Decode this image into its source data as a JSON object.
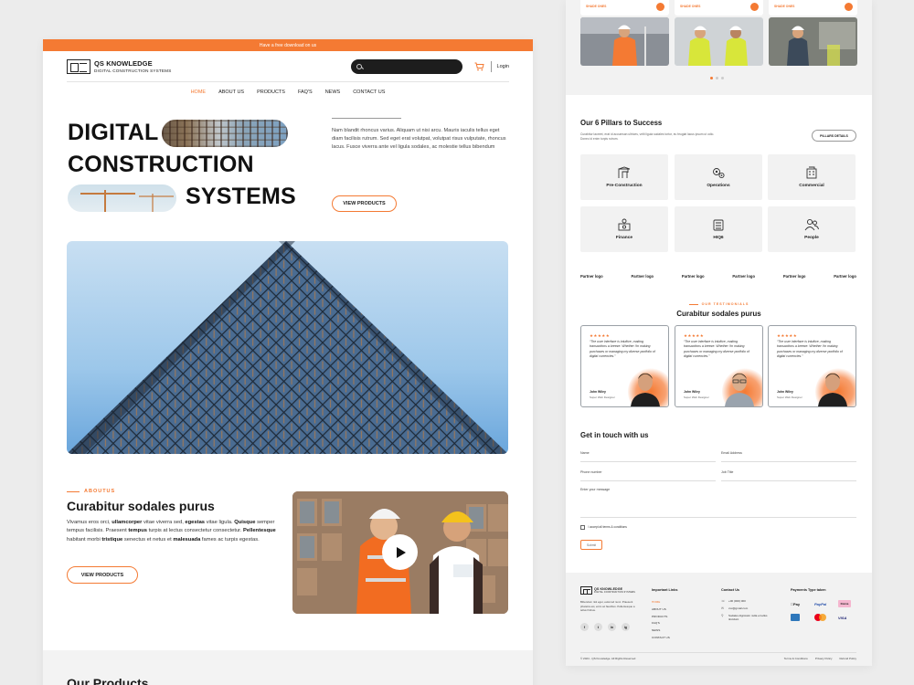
{
  "topbar": {
    "text": "Have a free download on us"
  },
  "brand": {
    "name": "QS KNOWLEDGE",
    "tagline": "DIGITAL CONSTRUCTION SYSTEMS"
  },
  "header": {
    "login": "Login",
    "search_placeholder": ""
  },
  "nav": [
    {
      "label": "HOME",
      "active": true
    },
    {
      "label": "ABOUT US"
    },
    {
      "label": "PRODUCTS"
    },
    {
      "label": "FAQ'S"
    },
    {
      "label": "NEWS"
    },
    {
      "label": "CONTACT US"
    }
  ],
  "hero": {
    "line1": "DIGITAL",
    "line2": "CONSTRUCTION",
    "line3": "SYSTEMS",
    "description": "Nam blandit rhoncus varius. Aliquam ut nisi arcu. Mauris iaculis tellus eget diam facilisis rutrum. Sed eget erat volutpat, volutpat risus vulputate, rhoncus lacus. Fusce viverra ante vel ligula sodales, ac molestie tellus bibendum",
    "cta": "VIEW PRODUCTS"
  },
  "about": {
    "tag": "ABOUTUS",
    "title": "Curabitur sodales purus",
    "text_html": "Vivamus eros orci, <b>ullamcorper</b> vitae viverra sed, <b>egestas</b> vitae ligula. <b>Quisque</b> semper tempus facilisis. Praesent <b>tempus</b> turpis at lectus consectetur consectetur. <b>Pellentesque</b> habitant morbi <b>tristique</b> senectus et netus et <b>malesuada</b> fames ac turpis egestas.",
    "cta": "VIEW PRODUCTS"
  },
  "products": {
    "title": "Our Products"
  },
  "top_cards": [
    {
      "label": "SHADE ONES"
    },
    {
      "label": "SHADE ONES"
    },
    {
      "label": "SHADE ONES"
    }
  ],
  "pillars": {
    "title": "Our 6 Pillars to Success",
    "description": "Curabitur laoreet, erat id accumsan ultrices, velit ligula sodales tortor, eu feugiat lacus ipsum ut odio. Donec id enim turpis rutrum.",
    "button": "PILLARS DETAILS",
    "items": [
      {
        "label": "Pre-Construction",
        "icon": "crane-icon"
      },
      {
        "label": "Operations",
        "icon": "gears-icon"
      },
      {
        "label": "Commercial",
        "icon": "building-icon"
      },
      {
        "label": "Finance",
        "icon": "money-icon"
      },
      {
        "label": "HIQ6",
        "icon": "office-icon"
      },
      {
        "label": "People",
        "icon": "people-icon"
      }
    ]
  },
  "partners": [
    "Partner logo",
    "Partner logo",
    "Partner logo",
    "Partner logo",
    "Partner logo",
    "Partner logo"
  ],
  "testimonials": {
    "tag": "OUR TESTIMONIALS",
    "title": "Curabitur sodales purus",
    "items": [
      {
        "stars": "★★★★★",
        "quote": "“The user interface is intuitive, making transactions a breeze. Whether I'm making purchases or managing my diverse portfolio of digital currencies.”",
        "name": "John Wiley",
        "role": "Super Web Designer"
      },
      {
        "stars": "★★★★★",
        "quote": "“The user interface is intuitive, making transactions a breeze. Whether I'm making purchases or managing my diverse portfolio of digital currencies.”",
        "name": "John Wiley",
        "role": "Super Web Designer"
      },
      {
        "stars": "★★★★★",
        "quote": "“The user interface is intuitive, making transactions a breeze. Whether I'm making purchases or managing my diverse portfolio of digital currencies.”",
        "name": "John Wiley",
        "role": "Super Web Designer"
      }
    ]
  },
  "contact": {
    "title": "Get in touch with us",
    "fields": {
      "name": "Name",
      "email": "Email Address",
      "phone": "Phone number",
      "job": "Job Title",
      "message": "Enter your message"
    },
    "terms": "I accept all terms & conditions",
    "submit": "Submit"
  },
  "footer": {
    "about": "Bibendum nisl eget, euismod nunc. Praesent pharetra est, enim ac faucibus. Pellentesque a tellus finibus.",
    "socials": [
      "f",
      "t",
      "in",
      "ig"
    ],
    "links_title": "Important Links",
    "links": [
      {
        "label": "HOME",
        "active": true
      },
      {
        "label": "ABOUT US"
      },
      {
        "label": "PRODUCTS"
      },
      {
        "label": "FAQ'S"
      },
      {
        "label": "NEWS"
      },
      {
        "label": "CONTACT US"
      }
    ],
    "contact_title": "Contact Us",
    "phone": "+00 (000) 000",
    "email": "xxx@gmail.com",
    "address": "Sodales dignissim nulla et tellus tincidunt",
    "payments_title": "Payments Type taken",
    "payments": {
      "applepay": "Pay",
      "paypal": "PayPal",
      "klarna": "Klarna",
      "visa": "VISA"
    },
    "copyright": "© 2024 - QS Knowledge. All Rights Reserved",
    "legal": [
      "Terms & Conditions",
      "Privacy Policy",
      "Refund Policy"
    ]
  },
  "colors": {
    "accent": "#f47a33",
    "dark": "#1d1d1d",
    "panel": "#f2f2f2"
  }
}
